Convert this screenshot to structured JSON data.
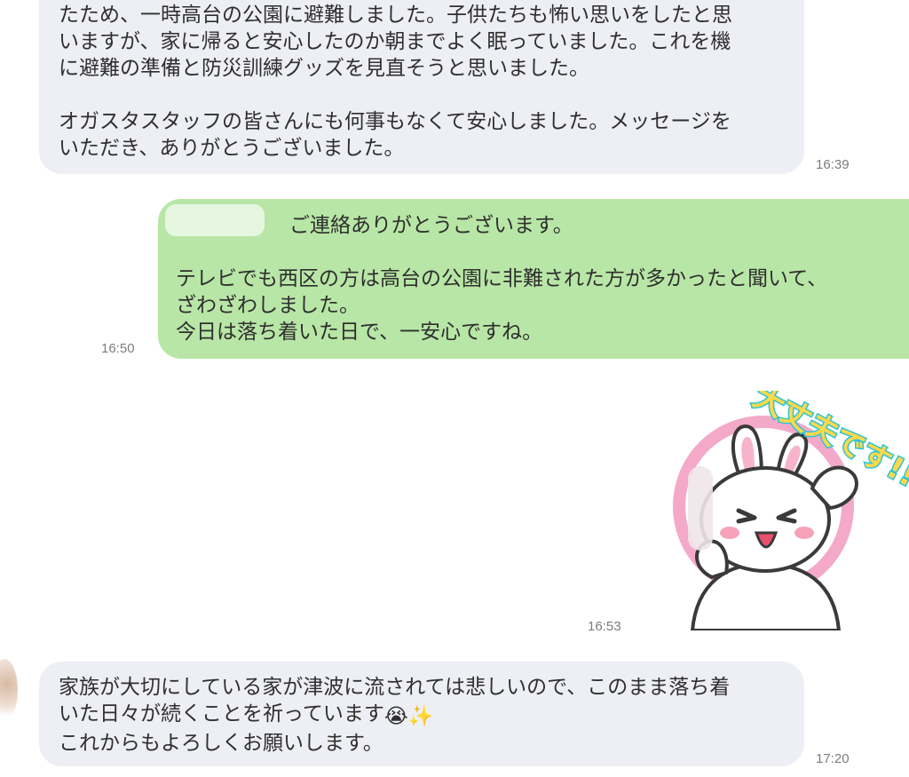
{
  "messages": [
    {
      "side": "received",
      "lines": [
        "たため、一時高台の公園に避難しました。子供たちも怖い思いをしたと思",
        "いますが、家に帰ると安心したのか朝までよく眠っていました。これを機",
        "に避難の準備と防災訓練グッズを見直そうと思いました。",
        "",
        "オガスタスタッフの皆さんにも何事もなくて安心しました。メッセージを",
        "いただき、ありがとうございました。"
      ],
      "time": "16:39"
    },
    {
      "side": "sent",
      "greeting": "ご連絡ありがとうございます。",
      "lines": [
        "テレビでも西区の方は高台の公園に非難された方が多かったと聞いて、",
        "ざわざわしました。",
        "今日は落ち着いた日で、一安心ですね。"
      ],
      "time": "16:50"
    },
    {
      "side": "sent",
      "sticker": {
        "caption": "大丈夫です!!",
        "icon": "bunny-sticker-icon",
        "colors": {
          "ring": "#f4a9c9",
          "text_fill": "#ffd94a",
          "text_stroke": "#2ec4d4"
        }
      },
      "time": "16:53"
    },
    {
      "side": "received",
      "lines": [
        "家族が大切にしている家が津波に流されては悲しいので、このまま落ち着",
        "いた日々が続くことを祈っています",
        "これからもよろしくお願いします。"
      ],
      "emoji": [
        "😭",
        "✨"
      ],
      "time": "17:20"
    }
  ],
  "colors": {
    "received_bubble": "#eeeff4",
    "sent_bubble": "#b8e6a6",
    "timestamp": "#7c7c7c"
  }
}
